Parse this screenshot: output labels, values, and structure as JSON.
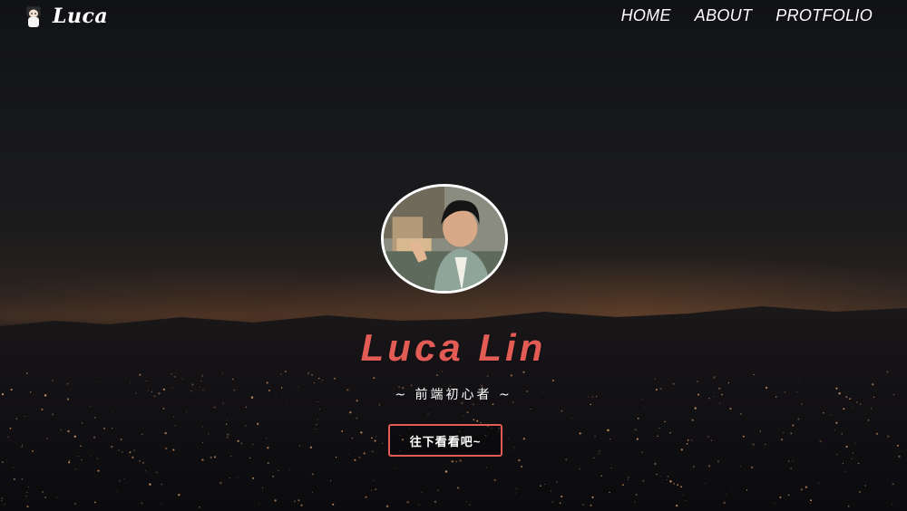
{
  "brand": {
    "name": "Luca",
    "logo_icon": "character-avatar-icon"
  },
  "nav": {
    "items": [
      {
        "label": "HOME"
      },
      {
        "label": "ABOUT"
      },
      {
        "label": "PROTFOLIO"
      }
    ]
  },
  "hero": {
    "avatar_icon": "profile-photo",
    "title": "Luca Lin",
    "subtitle": "~ 前端初心者 ~",
    "cta_label": "往下看看吧~"
  },
  "colors": {
    "accent": "#e25c55",
    "text": "#ffffff"
  }
}
